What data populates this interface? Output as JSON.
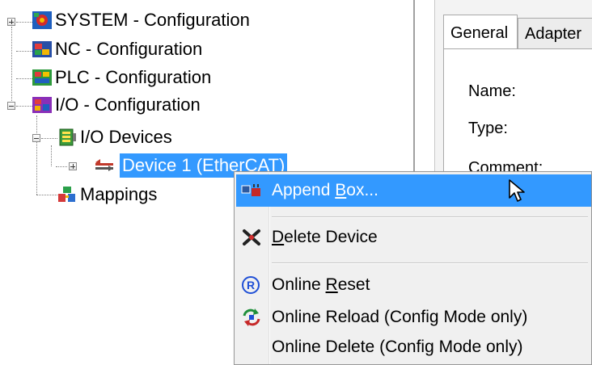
{
  "tree": {
    "nodes": [
      {
        "label": "SYSTEM - Configuration",
        "icon": "system-config-icon"
      },
      {
        "label": "NC - Configuration",
        "icon": "nc-config-icon"
      },
      {
        "label": "PLC - Configuration",
        "icon": "plc-config-icon"
      },
      {
        "label": "I/O - Configuration",
        "icon": "io-config-icon"
      },
      {
        "label": "I/O Devices",
        "icon": "io-devices-icon"
      },
      {
        "label": "Device 1 (EtherCAT)",
        "icon": "ethercat-device-icon",
        "selected": true
      },
      {
        "label": "Mappings",
        "icon": "mappings-icon"
      }
    ]
  },
  "panel": {
    "tabs": [
      "General",
      "Adapter"
    ],
    "active_tab": "General",
    "fields": [
      "Name:",
      "Type:",
      "Comment:"
    ]
  },
  "context_menu": {
    "items": [
      {
        "pre": "Append ",
        "mnemonic": "B",
        "post": "ox...",
        "icon": "append-box-icon",
        "highlighted": true
      },
      {
        "pre": "",
        "mnemonic": "D",
        "post": "elete Device",
        "icon": "delete-device-icon"
      },
      {
        "pre": "Online ",
        "mnemonic": "R",
        "post": "eset",
        "icon": "online-reset-icon"
      },
      {
        "pre": "Online Reload (Config Mode only)",
        "mnemonic": "",
        "post": "",
        "icon": "online-reload-icon"
      },
      {
        "pre": "Online Delete (Config Mode only)",
        "mnemonic": "",
        "post": "",
        "icon": ""
      }
    ]
  },
  "colors": {
    "selection": "#3399ff",
    "menu_background": "#f0f0f0",
    "panel_background": "#f3f3f3"
  }
}
